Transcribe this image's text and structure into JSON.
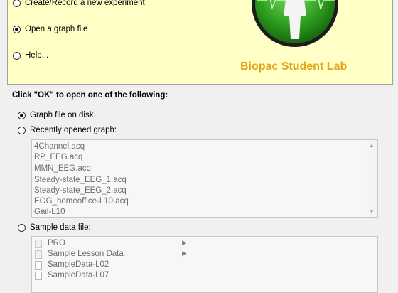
{
  "header_options": [
    {
      "label": "Create/Record a new experiment",
      "selected": false
    },
    {
      "label": "Open a graph file",
      "selected": true
    },
    {
      "label": "Help...",
      "selected": false
    }
  ],
  "brand": {
    "name": "Biopac Student Lab",
    "accent": "#e3a317",
    "logo_green": "#2e9e1f"
  },
  "instruction": "Click \"OK\" to open one of the following:",
  "open_options": {
    "graph_file_on_disk": {
      "label": "Graph file on disk...",
      "selected": true
    },
    "recently_opened": {
      "label": "Recently opened graph:",
      "selected": false
    },
    "sample_data": {
      "label": "Sample data file:",
      "selected": false
    }
  },
  "recent_files": [
    "4Channel.acq",
    "RP_EEG.acq",
    "MMN_EEG.acq",
    "Steady-state_EEG_1.acq",
    "Steady-state_EEG_2.acq",
    "EOG_homeoffice-L10.acq",
    "Gail-L10"
  ],
  "sample_items": [
    {
      "label": "PRO",
      "icon": "folder-icon",
      "has_children": true
    },
    {
      "label": "Sample Lesson Data",
      "icon": "folder-icon",
      "has_children": true
    },
    {
      "label": "SampleData-L02",
      "icon": "file-icon",
      "has_children": false
    },
    {
      "label": "SampleData-L07",
      "icon": "file-icon",
      "has_children": false
    }
  ]
}
